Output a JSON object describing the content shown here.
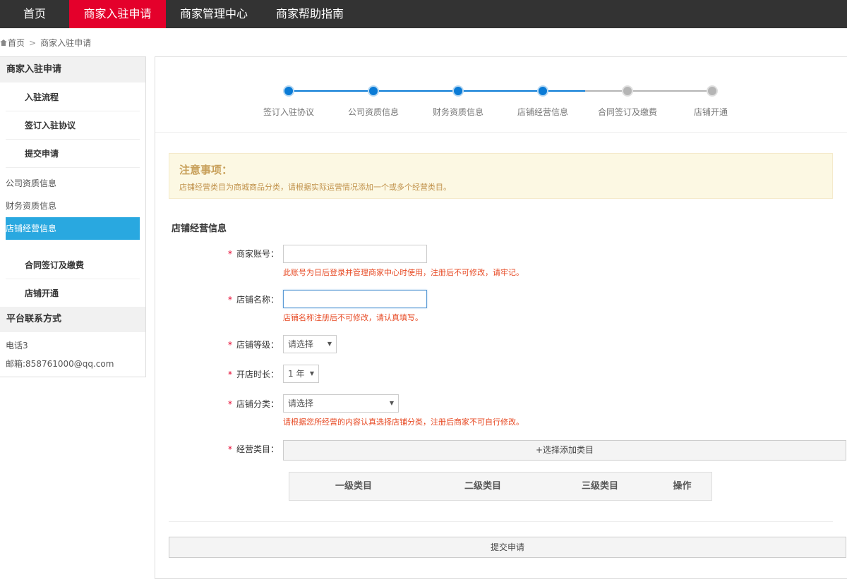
{
  "topnav": {
    "items": [
      {
        "label": "首页"
      },
      {
        "label": "商家入驻申请"
      },
      {
        "label": "商家管理中心"
      },
      {
        "label": "商家帮助指南"
      }
    ]
  },
  "breadcrumb": {
    "home": "首页",
    "sep": ">",
    "current": "商家入驻申请"
  },
  "sidebar": {
    "header1": "商家入驻申请",
    "items": [
      {
        "label": "入驻流程"
      },
      {
        "label": "签订入驻协议"
      },
      {
        "label": "提交申请"
      },
      {
        "label": "公司资质信息"
      },
      {
        "label": "财务资质信息"
      },
      {
        "label": "店铺经营信息"
      },
      {
        "label": "合同签订及缴费"
      },
      {
        "label": "店铺开通"
      }
    ],
    "header2": "平台联系方式",
    "contact_phone": "电话3",
    "contact_email": "邮箱:858761000@qq.com"
  },
  "steps": {
    "labels": [
      "签订入驻协议",
      "公司资质信息",
      "财务资质信息",
      "店铺经营信息",
      "合同签订及缴费",
      "店铺开通"
    ],
    "completed": 4,
    "colors": {
      "done": "#0a7bd6",
      "todo": "#b5b5b5"
    }
  },
  "notice": {
    "title": "注意事项：",
    "text": "店铺经营类目为商城商品分类，请根据实际运营情况添加一个或多个经营类目。"
  },
  "form": {
    "section_title": "店铺经营信息",
    "required_mark": "*",
    "account": {
      "label": "商家账号：",
      "value": "",
      "hint": "此账号为日后登录并管理商家中心时使用，注册后不可修改，请牢记。"
    },
    "store_name": {
      "label": "店铺名称：",
      "value": "",
      "hint": "店铺名称注册后不可修改，请认真填写。"
    },
    "store_level": {
      "label": "店铺等级：",
      "selected": "请选择"
    },
    "duration": {
      "label": "开店时长：",
      "selected": "1 年"
    },
    "store_category": {
      "label": "店铺分类：",
      "selected": "请选择",
      "hint": "请根据您所经营的内容认真选择店铺分类，注册后商家不可自行修改。"
    },
    "business_category": {
      "label": "经营类目：",
      "add_button": "+选择添加类目"
    },
    "table_headers": [
      "一级类目",
      "二级类目",
      "三级类目",
      "操作"
    ],
    "submit": "提交申请"
  },
  "caret_glyph": "▼",
  "accent": {
    "nav_active": "#e4002b",
    "sidebar_active": "#29a8e0",
    "hint": "#e74a24"
  }
}
